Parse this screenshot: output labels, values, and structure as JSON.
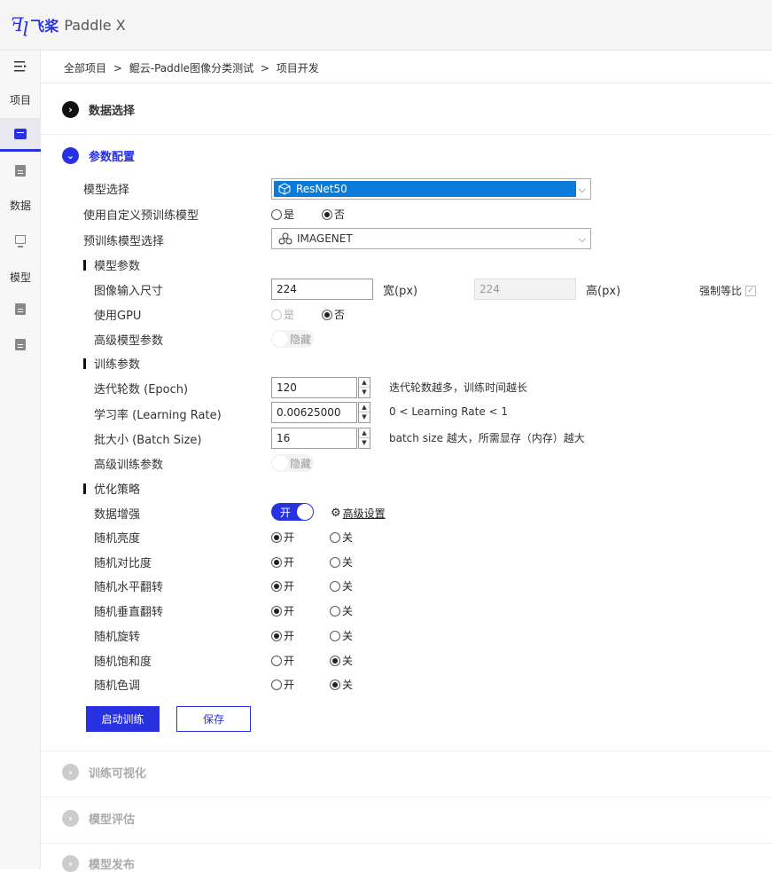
{
  "header": {
    "logo_mark": "ꟻꞁ",
    "logo_cn": "飞桨",
    "product": "Paddle X"
  },
  "sidebar": {
    "groups": [
      {
        "label": "项目"
      },
      {
        "label": "数据"
      },
      {
        "label": "模型"
      }
    ]
  },
  "breadcrumb": {
    "part1": "全部项目",
    "sep": ">",
    "part2": "鲲云-Paddle图像分类测试",
    "part3": "项目开发"
  },
  "sections": {
    "data_select": "数据选择",
    "param_config": "参数配置",
    "train_vis": "训练可视化",
    "model_eval": "模型评估",
    "model_publish": "模型发布"
  },
  "form": {
    "model_select_label": "模型选择",
    "model_select_value": "ResNet50",
    "custom_pretrain_label": "使用自定义预训练模型",
    "yes": "是",
    "no": "否",
    "pretrain_select_label": "预训练模型选择",
    "pretrain_select_value": "IMAGENET",
    "model_params_head": "模型参数",
    "img_size_label": "图像输入尺寸",
    "width_value": "224",
    "width_unit": "宽(px)",
    "height_value": "224",
    "height_unit": "高(px)",
    "force_ratio": "强制等比",
    "use_gpu_label": "使用GPU",
    "adv_model_label": "高级模型参数",
    "hidden": "隐藏",
    "train_params_head": "训练参数",
    "epoch_label": "迭代轮数 (Epoch)",
    "epoch_value": "120",
    "epoch_hint": "迭代轮数越多，训练时间越长",
    "lr_label": "学习率 (Learning Rate)",
    "lr_value": "0.00625000",
    "lr_hint": "0 < Learning Rate < 1",
    "batch_label": "批大小 (Batch Size)",
    "batch_value": "16",
    "batch_hint": "batch size 越大，所需显存（内存）越大",
    "adv_train_label": "高级训练参数",
    "opt_head": "优化策略",
    "aug_label": "数据增强",
    "toggle_on": "开",
    "adv_settings": "高级设置",
    "on": "开",
    "off": "关",
    "aug_rows": [
      {
        "label": "随机亮度",
        "state": "on"
      },
      {
        "label": "随机对比度",
        "state": "on"
      },
      {
        "label": "随机水平翻转",
        "state": "on"
      },
      {
        "label": "随机垂直翻转",
        "state": "on"
      },
      {
        "label": "随机旋转",
        "state": "on"
      },
      {
        "label": "随机饱和度",
        "state": "off"
      },
      {
        "label": "随机色调",
        "state": "off"
      }
    ]
  },
  "buttons": {
    "start": "启动训练",
    "save": "保存"
  },
  "colors": {
    "brand": "#2932e1",
    "select_highlight": "#0a7bd8"
  }
}
